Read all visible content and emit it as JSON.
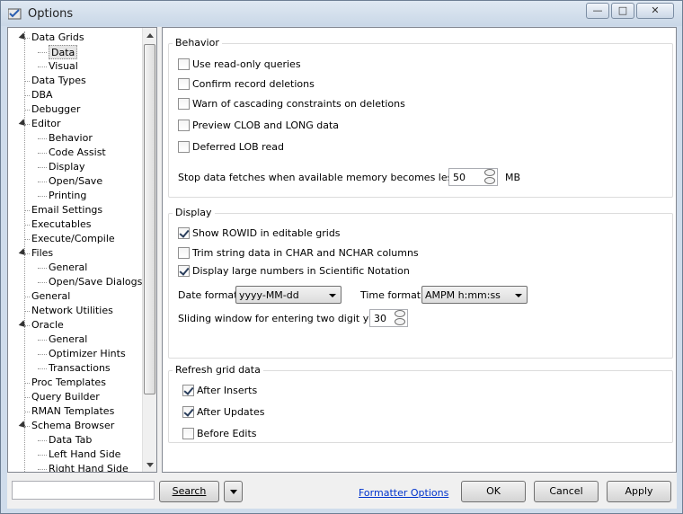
{
  "window": {
    "title": "Options",
    "minimize": "—",
    "maximize": "□",
    "close": "✕"
  },
  "tree": {
    "items": [
      {
        "label": "Data Grids",
        "level": 0,
        "expanded": true
      },
      {
        "label": "Data",
        "level": 1,
        "selected": true
      },
      {
        "label": "Visual",
        "level": 1
      },
      {
        "label": "Data Types",
        "level": 0
      },
      {
        "label": "DBA",
        "level": 0
      },
      {
        "label": "Debugger",
        "level": 0
      },
      {
        "label": "Editor",
        "level": 0,
        "expanded": true
      },
      {
        "label": "Behavior",
        "level": 1
      },
      {
        "label": "Code Assist",
        "level": 1
      },
      {
        "label": "Display",
        "level": 1
      },
      {
        "label": "Open/Save",
        "level": 1
      },
      {
        "label": "Printing",
        "level": 1
      },
      {
        "label": "Email Settings",
        "level": 0
      },
      {
        "label": "Executables",
        "level": 0
      },
      {
        "label": "Execute/Compile",
        "level": 0
      },
      {
        "label": "Files",
        "level": 0,
        "expanded": true
      },
      {
        "label": "General",
        "level": 1
      },
      {
        "label": "Open/Save Dialogs",
        "level": 1
      },
      {
        "label": "General",
        "level": 0
      },
      {
        "label": "Network Utilities",
        "level": 0
      },
      {
        "label": "Oracle",
        "level": 0,
        "expanded": true
      },
      {
        "label": "General",
        "level": 1
      },
      {
        "label": "Optimizer Hints",
        "level": 1
      },
      {
        "label": "Transactions",
        "level": 1
      },
      {
        "label": "Proc Templates",
        "level": 0
      },
      {
        "label": "Query Builder",
        "level": 0
      },
      {
        "label": "RMAN Templates",
        "level": 0
      },
      {
        "label": "Schema Browser",
        "level": 0,
        "expanded": true
      },
      {
        "label": "Data Tab",
        "level": 1
      },
      {
        "label": "Left Hand Side",
        "level": 1
      },
      {
        "label": "Right Hand Side",
        "level": 1
      }
    ]
  },
  "behavior": {
    "title": "Behavior",
    "read_only": {
      "label": "Use read-only queries",
      "checked": false
    },
    "confirm_delete": {
      "label": "Confirm record deletions",
      "checked": false
    },
    "warn_cascade": {
      "label": "Warn of cascading constraints on deletions",
      "checked": false
    },
    "preview_clob": {
      "label": "Preview CLOB and LONG data",
      "checked": false
    },
    "deferred_lob": {
      "label": "Deferred LOB read",
      "checked": false
    },
    "stop_fetch_label": "Stop data fetches when available memory becomes less than",
    "stop_fetch_value": "50",
    "stop_fetch_unit": "MB"
  },
  "display": {
    "title": "Display",
    "show_rowid": {
      "label": "Show ROWID in editable grids",
      "checked": true
    },
    "trim_string": {
      "label": "Trim string data in CHAR and NCHAR columns",
      "checked": false
    },
    "sci_notation": {
      "label": "Display large numbers in Scientific Notation",
      "checked": true
    },
    "date_format_label": "Date format:",
    "date_format_value": "yyyy-MM-dd",
    "time_format_label": "Time format:",
    "time_format_value": "AMPM h:mm:ss",
    "sliding_label": "Sliding window for entering two digit years",
    "sliding_value": "30"
  },
  "refresh": {
    "title": "Refresh grid data",
    "after_inserts": {
      "label": "After Inserts",
      "checked": true
    },
    "after_updates": {
      "label": "After Updates",
      "checked": true
    },
    "before_edits": {
      "label": "Before Edits",
      "checked": false
    }
  },
  "footer": {
    "search_value": "",
    "search_button": "Search",
    "formatter_link": "Formatter Options",
    "ok": "OK",
    "cancel": "Cancel",
    "apply": "Apply"
  }
}
